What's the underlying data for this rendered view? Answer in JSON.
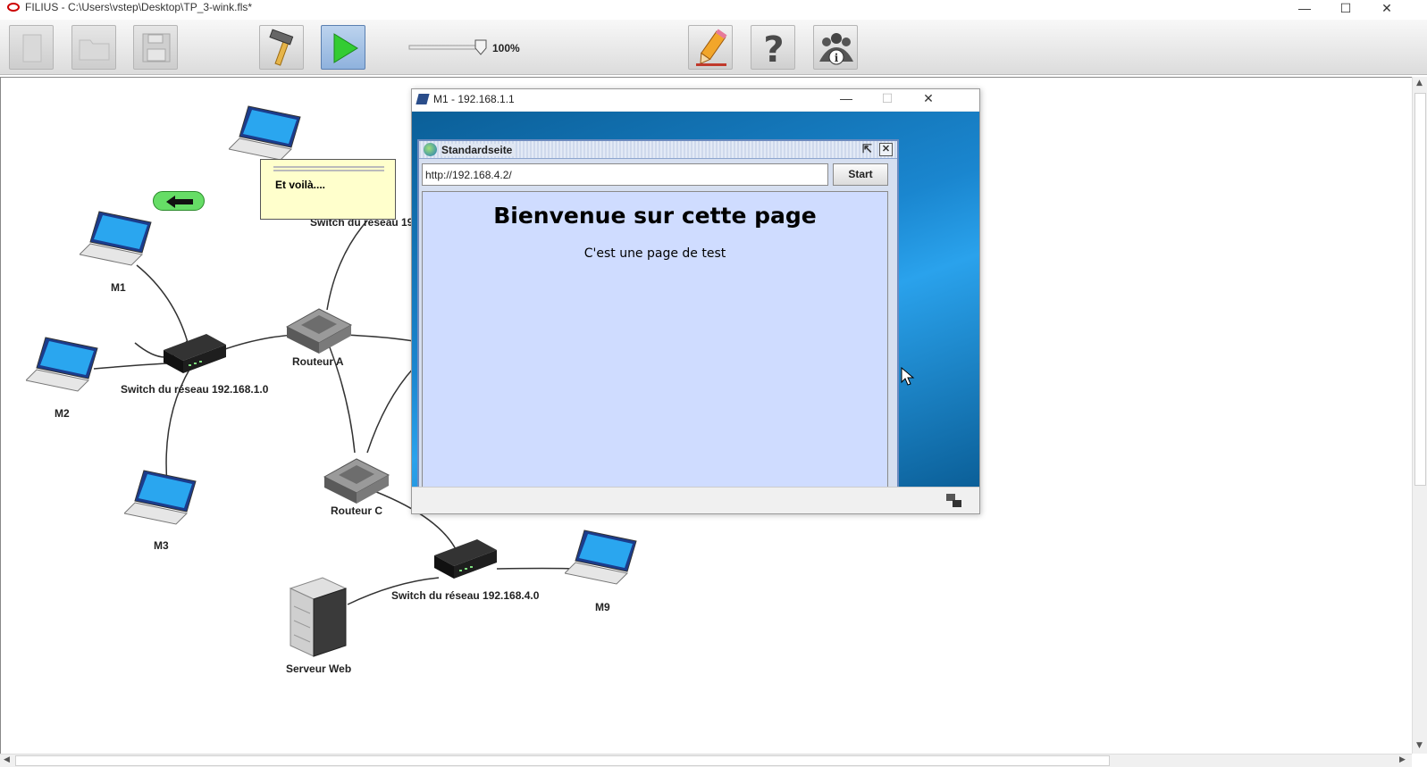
{
  "window": {
    "title": "FILIUS - C:\\Users\\vstep\\Desktop\\TP_3-wink.fls*",
    "minimize": "—",
    "maximize": "☐",
    "close": "✕"
  },
  "toolbar": {
    "zoom_level": "100%",
    "zoom_fraction": 1.0,
    "buttons": [
      {
        "icon": "new-file-icon",
        "state": "disabled"
      },
      {
        "icon": "open-folder-icon",
        "state": "disabled"
      },
      {
        "icon": "save-disk-icon",
        "state": "disabled"
      },
      {
        "icon": "hammer-icon",
        "state": "enabled"
      },
      {
        "icon": "play-icon",
        "state": "active"
      },
      {
        "icon": "pencil-icon",
        "state": "enabled"
      },
      {
        "icon": "help-icon",
        "state": "enabled"
      },
      {
        "icon": "info-people-icon",
        "state": "enabled"
      }
    ]
  },
  "network": {
    "nodes": {
      "m1": "M1",
      "m2": "M2",
      "m3": "M3",
      "m9": "M9",
      "switch1": "Switch du réseau 192.168.1.0",
      "switch_partial": "Switch du réseau 19",
      "switch4": "Switch du réseau 192.168.4.0",
      "routeur_a": "Routeur A",
      "routeur_c": "Routeur C",
      "serveur_web": "Serveur Web"
    },
    "note": {
      "text": "Et voilà...."
    }
  },
  "m1_window": {
    "title": "M1 - 192.168.1.1",
    "browser": {
      "title": "Standardseite",
      "url": "http://192.168.4.2/",
      "start_label": "Start",
      "heading": "Bienvenue sur cette page",
      "body": "C'est une page de test",
      "page_bg": "#cfdcff"
    }
  },
  "colors": {
    "accent_green": "#33cc33",
    "desktop_blue": "#1a86cf"
  }
}
